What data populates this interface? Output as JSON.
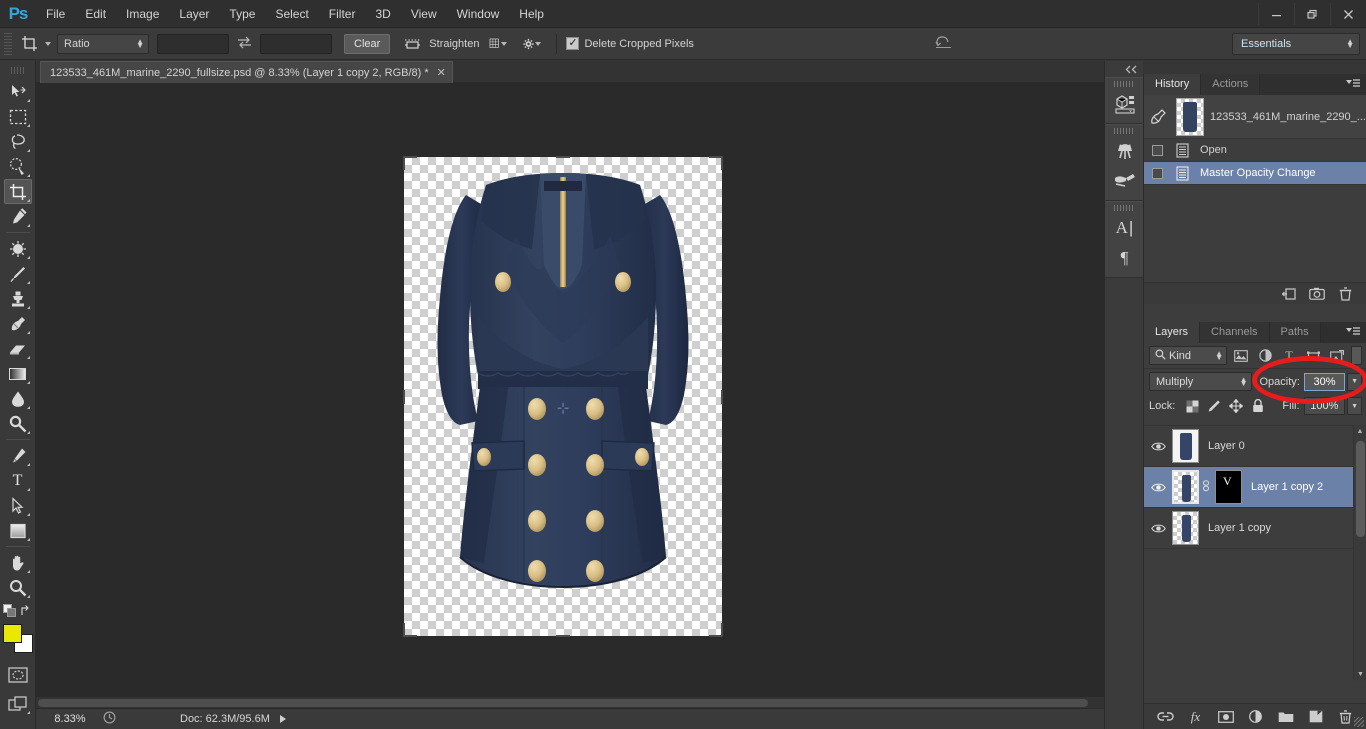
{
  "app": {
    "logo": "Ps"
  },
  "menubar": {
    "items": [
      "File",
      "Edit",
      "Image",
      "Layer",
      "Type",
      "Select",
      "Filter",
      "3D",
      "View",
      "Window",
      "Help"
    ],
    "window_controls": {
      "minimize": "—",
      "restore": "❐",
      "close": "✕"
    }
  },
  "options_bar": {
    "tool_icon": "crop-tool-icon",
    "ratio_select": "Ratio",
    "width_value": "",
    "height_value": "",
    "swap_icon": "swap-arrows-icon",
    "clear_button": "Clear",
    "straighten_icon": "straighten-icon",
    "straighten_label": "Straighten",
    "overlay_icon": "crop-overlay-grid-icon",
    "settings_icon": "gear-icon",
    "delete_cropped_checkbox": {
      "label": "Delete Cropped Pixels",
      "checked": true,
      "mark": "✓"
    },
    "reset_icon": "reset-arrow-icon",
    "workspace_select": "Essentials"
  },
  "tabbar": {
    "document_title": "123533_461M_marine_2290_fullsize.psd @ 8.33% (Layer 1 copy 2, RGB/8) *",
    "close": "✕"
  },
  "toolbar": {
    "tools": [
      {
        "name": "move-tool",
        "active": false
      },
      {
        "name": "rectangular-marquee-tool",
        "active": false
      },
      {
        "name": "lasso-tool",
        "active": false
      },
      {
        "name": "quick-selection-tool",
        "active": false
      },
      {
        "name": "crop-tool",
        "active": true
      },
      {
        "name": "eyedropper-tool",
        "active": false
      },
      {
        "name": "spot-healing-brush-tool",
        "active": false
      },
      {
        "name": "brush-tool",
        "active": false
      },
      {
        "name": "clone-stamp-tool",
        "active": false
      },
      {
        "name": "history-brush-tool",
        "active": false
      },
      {
        "name": "eraser-tool",
        "active": false
      },
      {
        "name": "gradient-tool",
        "active": false
      },
      {
        "name": "blur-tool",
        "active": false
      },
      {
        "name": "dodge-tool",
        "active": false
      },
      {
        "name": "pen-tool",
        "active": false
      },
      {
        "name": "type-tool",
        "active": false
      },
      {
        "name": "path-selection-tool",
        "active": false
      },
      {
        "name": "rectangle-tool",
        "active": false
      },
      {
        "name": "hand-tool",
        "active": false
      },
      {
        "name": "zoom-tool",
        "active": false
      }
    ],
    "type_tool_glyph": "T",
    "foreground_color": "#e8e800",
    "background_color": "#ffffff",
    "quick_mask_icon": "quick-mask-icon",
    "screen_mode_icon": "screen-mode-icon"
  },
  "canvas": {
    "artwork_alt": "navy blue double-breasted dress with gold buttons",
    "dress_color": "#2e3d5c",
    "dress_shadow_color": "#1d2840",
    "button_color": "#d8c084",
    "target_marker": "⊹"
  },
  "statusbar": {
    "zoom": "8.33%",
    "preview_icon": "preview-icon",
    "doc_info": "Doc: 62.3M/95.6M"
  },
  "rail": {
    "collapse_icon": "collapse-dock-icon",
    "buttons": [
      "mini-bridge-icon",
      "brush-panel-icon",
      "brush-presets-icon",
      "character-panel-icon",
      "paragraph-panel-icon"
    ],
    "character_glyph": "A",
    "paragraph_glyph": "¶"
  },
  "history_panel": {
    "tabs": [
      {
        "label": "History",
        "active": true
      },
      {
        "label": "Actions",
        "active": false
      }
    ],
    "menu_icon": "panel-menu-icon",
    "rows": [
      {
        "label": "123533_461M_marine_2290_...",
        "type": "snapshot",
        "selected": false
      },
      {
        "label": "Open",
        "type": "state",
        "selected": false
      },
      {
        "label": "Master Opacity Change",
        "type": "state",
        "selected": true
      }
    ],
    "footer_buttons": [
      "new-document-from-state-icon",
      "new-snapshot-icon",
      "delete-state-icon"
    ]
  },
  "layers_panel": {
    "tabs": [
      {
        "label": "Layers",
        "active": true
      },
      {
        "label": "Channels",
        "active": false
      },
      {
        "label": "Paths",
        "active": false
      }
    ],
    "menu_icon": "panel-menu-icon",
    "filter": {
      "kind_label": "Kind",
      "search_icon": "search-icon",
      "icons": [
        "pixel-layer-filter-icon",
        "adjustment-layer-filter-icon",
        "type-layer-filter-icon",
        "shape-layer-filter-icon",
        "smart-object-filter-icon"
      ],
      "type_glyph": "T"
    },
    "blend_mode": "Multiply",
    "opacity_label": "Opacity:",
    "opacity_value": "30%",
    "lock_label": "Lock:",
    "lock_icons": [
      "lock-transparent-pixels-icon",
      "lock-image-pixels-icon",
      "lock-position-icon",
      "lock-all-icon"
    ],
    "fill_label": "Fill:",
    "fill_value": "100%",
    "layers": [
      {
        "name": "Layer 0",
        "visible": true,
        "selected": false,
        "has_mask": false,
        "thumb": "dress-thumbnail"
      },
      {
        "name": "Layer 1 copy 2",
        "visible": true,
        "selected": true,
        "has_mask": true,
        "thumb": "dress-thumbnail",
        "mask_glyph": "V"
      },
      {
        "name": "Layer 1 copy",
        "visible": true,
        "selected": false,
        "has_mask": false,
        "thumb": "dress-thumbnail"
      }
    ],
    "eye_glyph": "👁",
    "footer_buttons": [
      "link-layers-icon",
      "layer-style-fx-icon",
      "add-layer-mask-icon",
      "new-adjustment-layer-icon",
      "new-group-icon",
      "new-layer-icon",
      "delete-layer-icon"
    ],
    "fx_glyph": "fx"
  },
  "annotation": {
    "shape": "ellipse",
    "color": "#e81c1c",
    "target": "opacity-field"
  }
}
